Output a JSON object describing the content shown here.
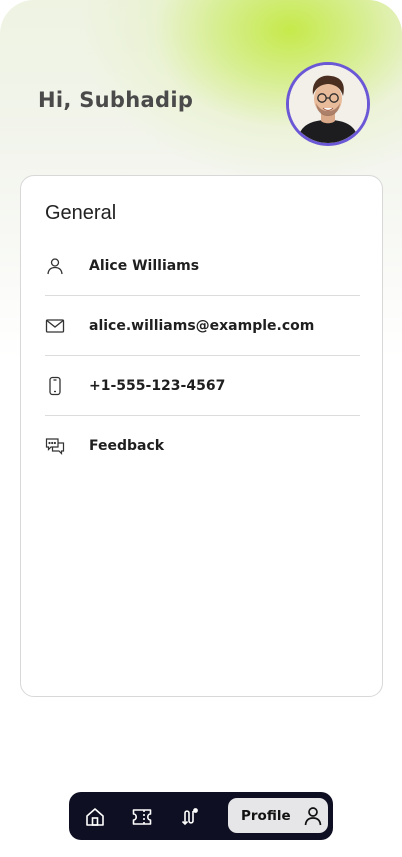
{
  "header": {
    "greeting": "Hi, Subhadip",
    "avatar_icon": "user-avatar-photo",
    "accent_color": "#c4e942",
    "avatar_border_color": "#6a58d6"
  },
  "card": {
    "title": "General",
    "rows": [
      {
        "icon": "person-icon",
        "label": "Alice Williams"
      },
      {
        "icon": "mail-icon",
        "label": "alice.williams@example.com"
      },
      {
        "icon": "phone-icon",
        "label": "+1-555-123-4567"
      },
      {
        "icon": "chat-feedback-icon",
        "label": "Feedback"
      }
    ]
  },
  "nav": {
    "items": [
      {
        "icon": "home-icon"
      },
      {
        "icon": "ticket-icon"
      },
      {
        "icon": "route-icon"
      },
      {
        "icon": "profile-icon",
        "label": "Profile",
        "active": true
      }
    ],
    "background": "#0e0f22",
    "active_background": "#e6e6e8"
  }
}
